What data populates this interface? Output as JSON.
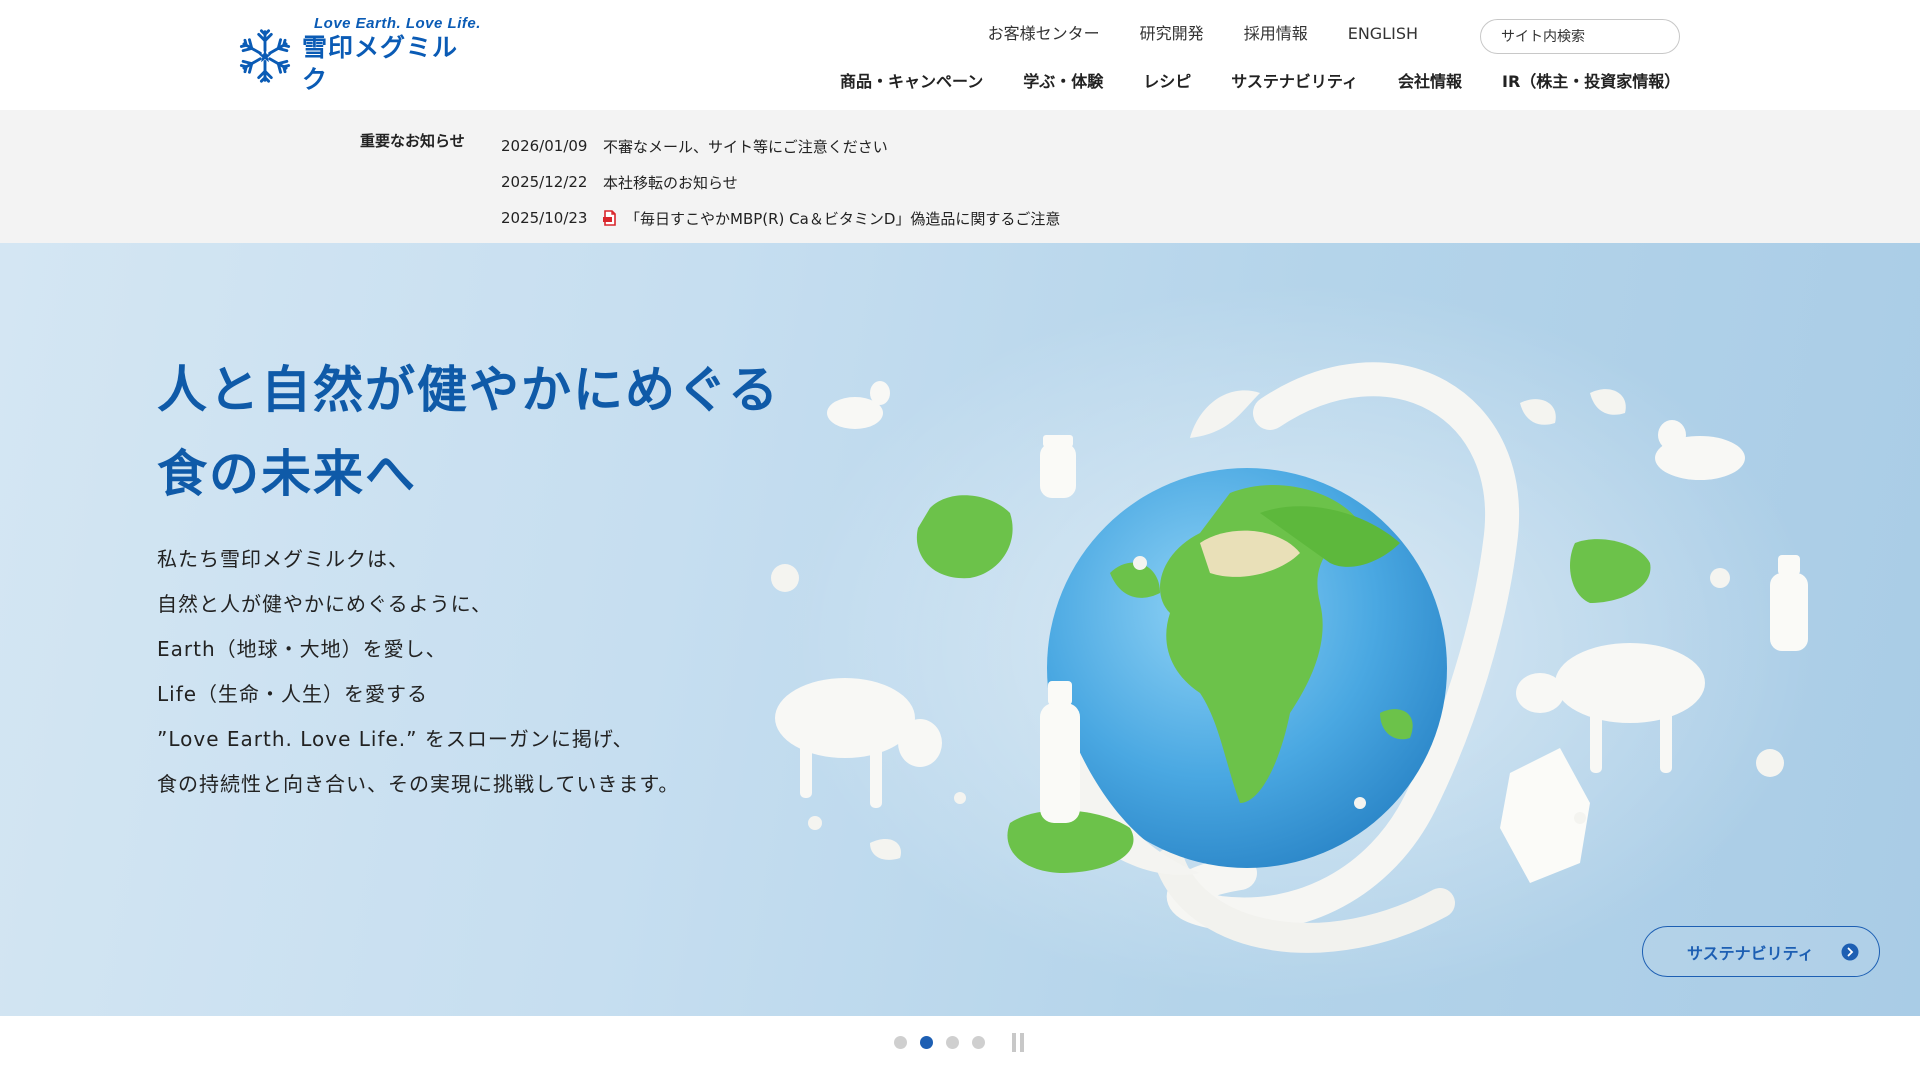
{
  "brand": {
    "tagline": "Love Earth. Love Life.",
    "name": "雪印メグミルク",
    "logo_icon": "snowflake-icon",
    "color": "#0a5bb5"
  },
  "utility_nav": [
    {
      "label": "お客様センター"
    },
    {
      "label": "研究開発"
    },
    {
      "label": "採用情報"
    },
    {
      "label": "ENGLISH"
    }
  ],
  "search": {
    "placeholder": "サイト内検索",
    "icon": "search-icon"
  },
  "main_nav": [
    {
      "label": "商品・キャンペーン"
    },
    {
      "label": "学ぶ・体験"
    },
    {
      "label": "レシピ"
    },
    {
      "label": "サステナビリティ"
    },
    {
      "label": "会社情報"
    },
    {
      "label": "IR（株主・投資家情報）"
    }
  ],
  "notices": {
    "heading": "重要なお知らせ",
    "items": [
      {
        "date": "2026/01/09",
        "title": "不審なメール、サイト等にご注意ください",
        "pdf": false
      },
      {
        "date": "2025/12/22",
        "title": "本社移転のお知らせ",
        "pdf": false
      },
      {
        "date": "2025/10/23",
        "title": "「毎日すこやかMBP(R)  Ca＆ビタミンD」偽造品に関するご注意",
        "pdf": true
      }
    ],
    "pdf_icon": "pdf-icon",
    "pdf_color": "#d9262c"
  },
  "hero": {
    "title_lines": [
      "人と自然が健やかにめぐる",
      "食の未来へ"
    ],
    "body_lines": [
      "私たち雪印メグミルクは、",
      "自然と人が健やかにめぐるように、",
      "Earth（地球・大地）を愛し、",
      "Life（生命・人生）を愛する",
      "”Love Earth. Love Life.” をスローガンに掲げ、",
      "食の持続性と向き合い、その実現に挑戦していきます。"
    ],
    "cta_label": "サステナビリティ",
    "cta_icon": "arrow-right-circle-icon",
    "title_color": "#0f5aa8",
    "accent_color": "#1d5fb3"
  },
  "carousel": {
    "slide_count": 4,
    "active_index": 1,
    "pause_icon": "pause-icon"
  }
}
